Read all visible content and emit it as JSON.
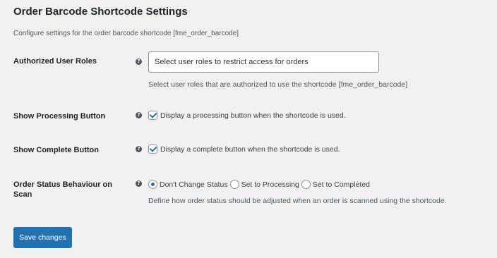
{
  "page": {
    "title": "Order Barcode Shortcode Settings",
    "description": "Configure settings for the order barcode shortcode [fme_order_barcode]"
  },
  "fields": {
    "user_roles": {
      "label": "Authorized User Roles",
      "placeholder": "Select user roles to restrict access for orders",
      "description": "Select user roles that are authorized to use the shortcode [fme_order_barcode]"
    },
    "processing_button": {
      "label": "Show Processing Button",
      "checked": true,
      "checkbox_label": "Display a processing button when the shortcode is used."
    },
    "complete_button": {
      "label": "Show Complete Button",
      "checked": true,
      "checkbox_label": "Display a complete button when the shortcode is used."
    },
    "order_status": {
      "label": "Order Status Behaviour on Scan",
      "options": [
        "Don't Change Status",
        "Set to Processing",
        "Set to Completed"
      ],
      "selected": "Don't Change Status",
      "description": "Define how order status should be adjusted when an order is scanned using the shortcode."
    }
  },
  "help_icon_glyph": "?",
  "save_button": {
    "label": "Save changes"
  },
  "colors": {
    "background": "#f1f1f1",
    "accent": "#2271b1"
  }
}
